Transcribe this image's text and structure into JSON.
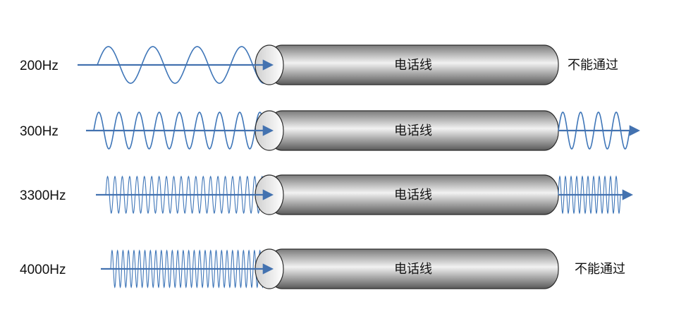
{
  "colors": {
    "wave": "#3f76b8",
    "arrow": "#4372b0",
    "tube_dark": "#5a5a5a",
    "tube_light": "#f2f2f2",
    "tube_outline": "#2a2a2a"
  },
  "rows": [
    {
      "frequency": "200Hz",
      "cable_label": "电话线",
      "passes": false,
      "result": "不能通过",
      "wave_cycles_before": 4,
      "wave_cycles_after": 0
    },
    {
      "frequency": "300Hz",
      "cable_label": "电话线",
      "passes": true,
      "result": "",
      "wave_cycles_before": 9,
      "wave_cycles_after": 4
    },
    {
      "frequency": "3300Hz",
      "cable_label": "电话线",
      "passes": true,
      "result": "",
      "wave_cycles_before": 23,
      "wave_cycles_after": 11
    },
    {
      "frequency": "4000Hz",
      "cable_label": "电话线",
      "passes": false,
      "result": "不能通过",
      "wave_cycles_before": 30,
      "wave_cycles_after": 0
    }
  ]
}
